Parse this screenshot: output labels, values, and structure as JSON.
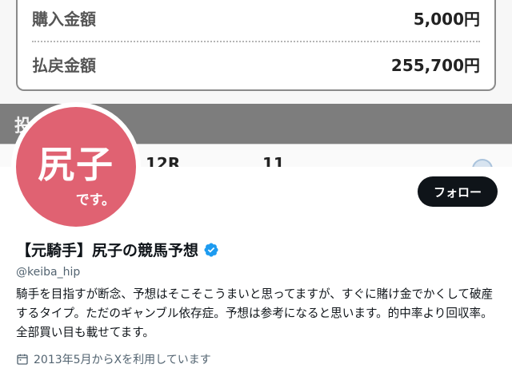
{
  "banner": {
    "purchase_label": "購入金額",
    "purchase_value": "5,000円",
    "payout_label": "払戻金額",
    "payout_value": "255,700円",
    "section_title": "投",
    "race_label": "12R",
    "number_label": "11"
  },
  "avatar": {
    "big_text": "尻子",
    "small_text": "です。"
  },
  "profile": {
    "display_name": "【元騎手】尻子の競馬予想",
    "handle": "@keiba_hip",
    "bio": "騎手を目指すが断念、予想はそこそこうまいと思ってますが、すぐに賭け金でかくして破産するタイプ。ただのギャンブル依存症。予想は参考になると思います。的中率より回収率。全部買い目も載せてます。",
    "joined": "2013年5月からXを利用しています",
    "follow_label": "フォロー"
  },
  "colors": {
    "avatar_bg": "#e06272",
    "verified": "#1d9bf0",
    "follow_bg": "#0f1419"
  },
  "icons": {
    "verified": "verified-badge-icon",
    "calendar": "calendar-icon"
  }
}
